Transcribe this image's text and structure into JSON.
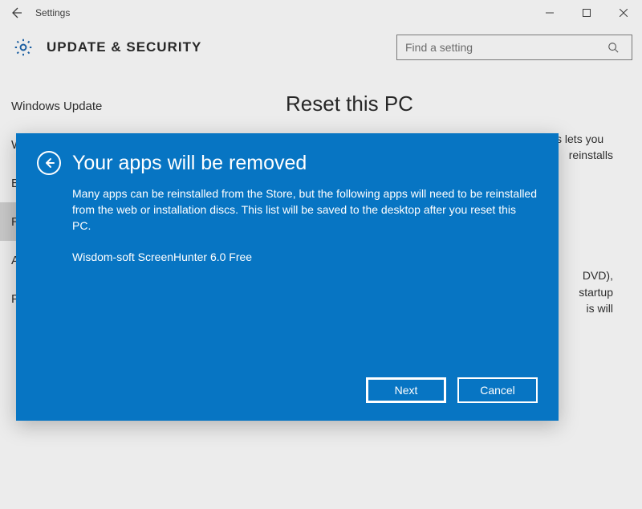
{
  "titlebar": {
    "title": "Settings"
  },
  "hero": {
    "title": "UPDATE & SECURITY"
  },
  "search": {
    "placeholder": "Find a setting"
  },
  "sidebar": {
    "items": [
      {
        "label": "Windows Update"
      },
      {
        "label": "Windows Defender"
      },
      {
        "label": "B"
      },
      {
        "label": "R"
      },
      {
        "label": "A"
      },
      {
        "label": "F"
      }
    ],
    "selected_index": 3
  },
  "content": {
    "heading": "Reset this PC",
    "intro_line": "If your PC isn't running well, resetting it might help. This lets you",
    "intro_frag_reinstalls": "reinstalls",
    "adv_frag": "DVD),\nstartup\nis will"
  },
  "dialog": {
    "title": "Your apps will be removed",
    "body": "Many apps can be reinstalled from the Store, but the following apps will need to be reinstalled from the web or installation discs. This list will be saved to the desktop after you reset this PC.",
    "apps": [
      "Wisdom-soft ScreenHunter 6.0 Free"
    ],
    "buttons": {
      "next": "Next",
      "cancel": "Cancel"
    }
  }
}
